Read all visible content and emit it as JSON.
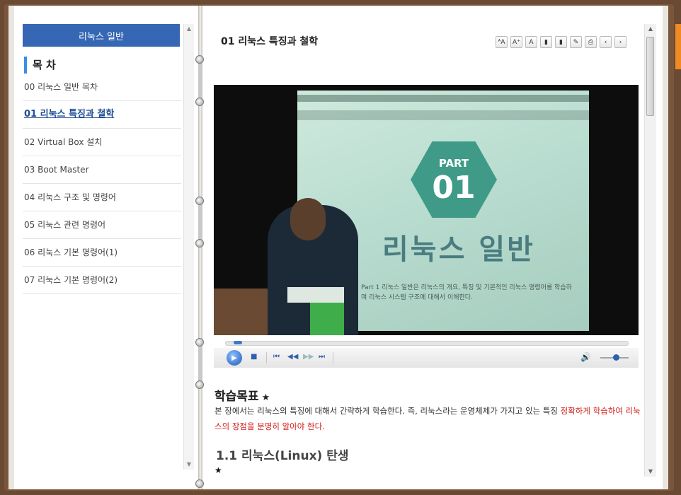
{
  "left": {
    "header": "리눅스 일반",
    "toc_title": "목 차",
    "items": [
      "00 리눅스 일반 목차",
      "01 리눅스 특징과 철학",
      "02 Virtual Box 설치",
      "03 Boot Master",
      "04 리눅스 구조 및 명령어",
      "05 리눅스 관련 명령어",
      "06 리눅스 기본 명령어(1)",
      "07 리눅스 기본 명령어(2)"
    ]
  },
  "right": {
    "chapter_title": "01 리눅스 특징과 철학",
    "toolbar_icons": [
      "font-small-icon",
      "font-large-icon",
      "font-reset-icon",
      "bookmark-icon",
      "bookmark-list-icon",
      "memo-icon",
      "print-icon",
      "prev-icon",
      "next-icon"
    ],
    "slide": {
      "part_label": "PART",
      "part_number": "01",
      "title": "리눅스 일반",
      "text": "Part 1 리눅스 일반은 리눅스의 개요, 특징 및 기본적인 리눅스 명령어를 학습하며 리눅스 시스템 구조에 대해서 이해한다."
    },
    "video_progress": 0.02,
    "volume_level": 0.55,
    "goal_heading": "학습목표",
    "star": "★",
    "paragraph_normal": "본 장에서는 리눅스의 특징에 대해서 간략하게 학습한다. 즉, 리눅스라는 운영체제가 가지고 있는 특징 ",
    "paragraph_highlight": "정확하게 학습하여 리눅스의 장점을 분명히 알아야 한다.",
    "section_heading": "1.1 리눅스(Linux) 탄생"
  }
}
